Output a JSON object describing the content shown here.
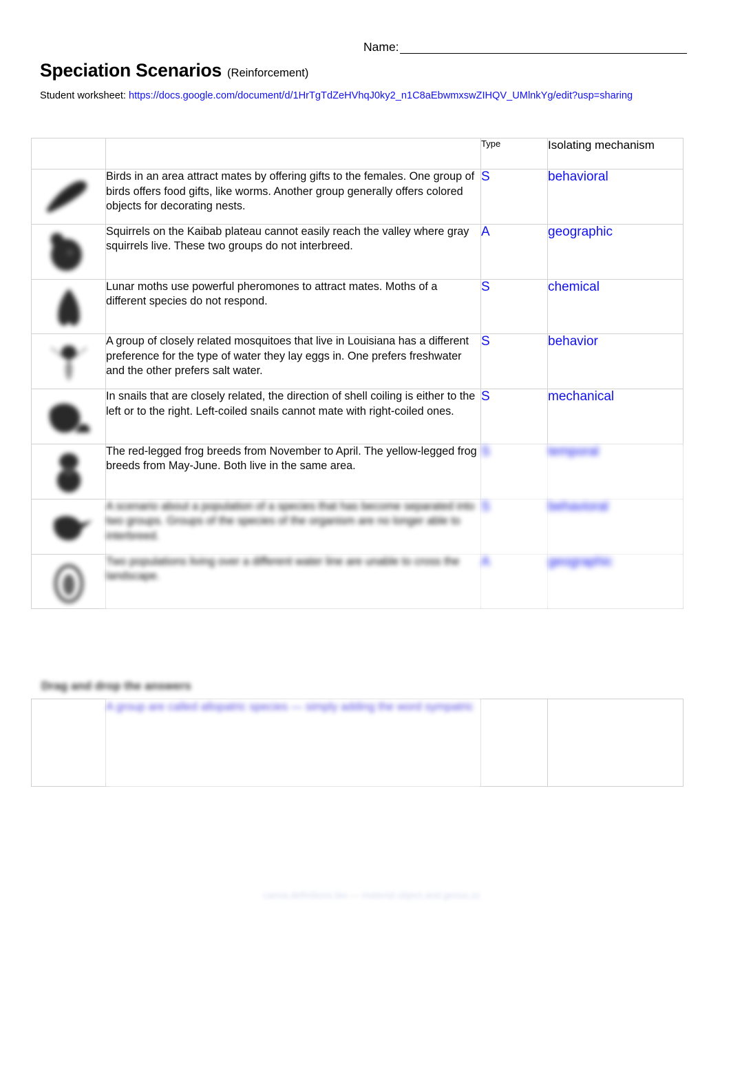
{
  "header": {
    "name_label": "Name:",
    "title": "Speciation Scenarios",
    "subtitle": "(Reinforcement)",
    "worksheet_label": "Student worksheet: ",
    "worksheet_url": "https://docs.google.com/document/d/1HrTgTdZeHVhqJ0ky2_n1C8aEbwmxswZIHQV_UMlnkYg/edit?usp=sharing"
  },
  "table": {
    "columns": {
      "image": "",
      "scenario": "",
      "type": "Type",
      "mechanism": "Isolating mechanism"
    },
    "rows": [
      {
        "icon": "bird-silhouette-icon",
        "scenario": "Birds in an area attract mates by offering gifts to the females. One group of birds offers food gifts, like worms.  Another group generally offers colored objects for decorating nests.",
        "type": "S",
        "mechanism": "behavioral",
        "obscured": false
      },
      {
        "icon": "squirrel-silhouette-icon",
        "scenario": "Squirrels on the Kaibab plateau  cannot easily reach the valley where gray squirrels live. These two groups do not interbreed.",
        "type": "A",
        "mechanism": "geographic",
        "obscured": false
      },
      {
        "icon": "moth-silhouette-icon",
        "scenario": "Lunar moths use powerful pheromones to attract mates. Moths of a different species do not respond.",
        "type": "S",
        "mechanism": "chemical",
        "obscured": false
      },
      {
        "icon": "mosquito-silhouette-icon",
        "scenario": "A group of closely related mosquitoes that live in Louisiana has a different preference for the type of water they lay eggs in. One prefers freshwater and the other prefers salt water.",
        "type": "S",
        "mechanism": "behavior",
        "obscured": false
      },
      {
        "icon": "snail-silhouette-icon",
        "scenario": "In snails that are closely related, the direction of shell coiling is either to the left or to the right. Left-coiled snails cannot mate with right-coiled ones.",
        "type": "S",
        "mechanism": "mechanical",
        "obscured": false
      },
      {
        "icon": "frog-silhouette-icon",
        "scenario": "The red-legged frog breeds from November to April.  The yellow-legged frog breeds from May-June.  Both live in the same area.",
        "type": "S",
        "mechanism": "temporal",
        "obscured": true
      },
      {
        "icon": "bird-head-silhouette-icon",
        "scenario": "A scenario about a population of a species that has become separated into two groups. Groups of the species of the organism are no longer able to interbreed.",
        "type": "S",
        "mechanism": "behavioral",
        "obscured": true
      },
      {
        "icon": "beetle-silhouette-icon",
        "scenario": "Two populations living over a different water line are unable to cross the landscape.",
        "type": "A",
        "mechanism": "geographic",
        "obscured": true
      }
    ]
  },
  "bank": {
    "caption": "Drag and drop the answers",
    "answer_text": "A group are called allopatric species — simply adding the word sympatric"
  },
  "footer": {
    "left": "canva.definitions.bio",
    "separator": "—",
    "right": "material.object.and.genus.zz"
  },
  "colors": {
    "answer_blue": "#1111ee",
    "link_blue": "#1111ee",
    "border_gray": "#d2d2d2",
    "text_black": "#000000"
  }
}
